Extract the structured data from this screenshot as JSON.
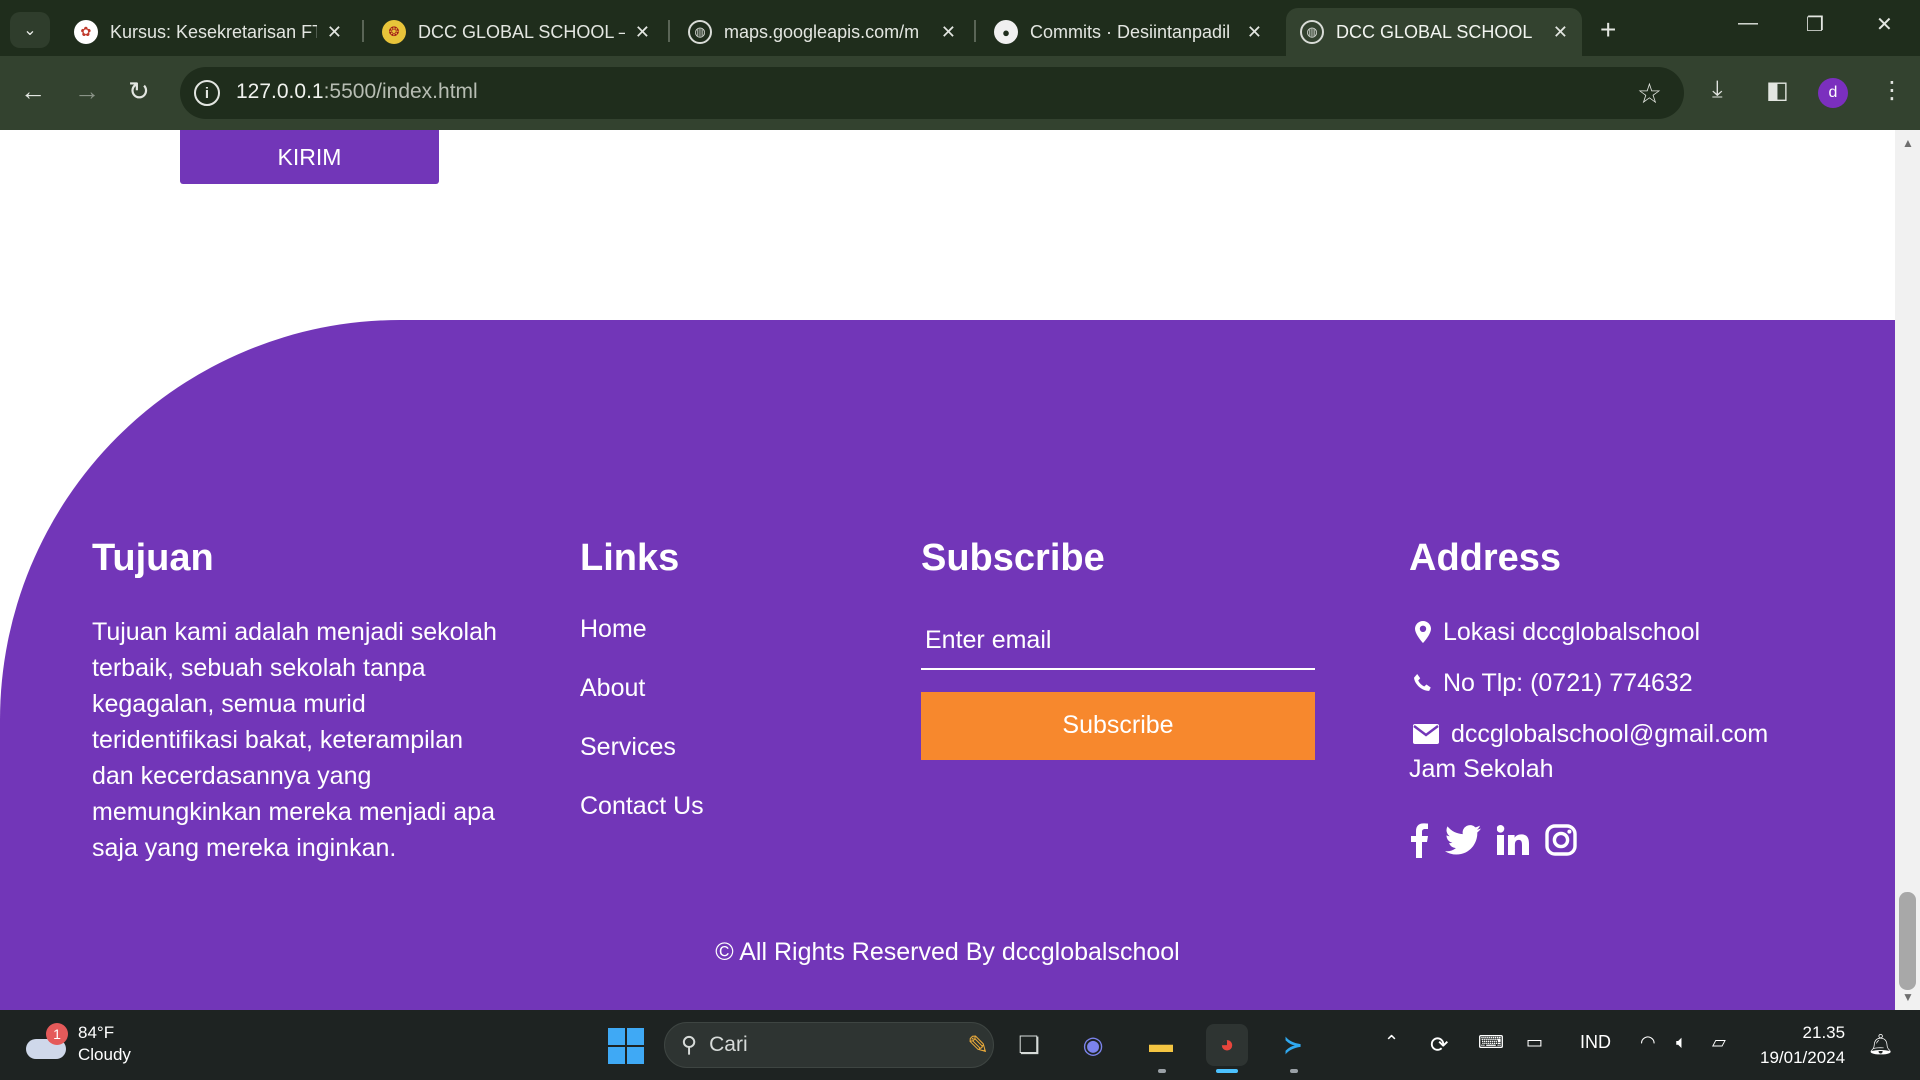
{
  "browser": {
    "tabs": [
      {
        "title": "Kursus: Kesekretarisan FT",
        "favicon": "university-favicon",
        "active": false
      },
      {
        "title": "DCC GLOBAL SCHOOL – |",
        "favicon": "school-logo-favicon",
        "active": false
      },
      {
        "title": "maps.googleapis.com/m",
        "favicon": "globe-favicon",
        "active": false
      },
      {
        "title": "Commits · Desiintanpadil",
        "favicon": "github-favicon",
        "active": false
      },
      {
        "title": "DCC GLOBAL SCHOOL",
        "favicon": "globe-favicon",
        "active": true
      }
    ],
    "url_host": "127.0.0.1",
    "url_path": ":5500/index.html",
    "profile_initial": "d"
  },
  "page": {
    "kirim_label": "KIRIM",
    "footer": {
      "tujuan": {
        "heading": "Tujuan",
        "text": "Tujuan kami adalah menjadi sekolah terbaik, sebuah sekolah tanpa kegagalan, semua murid teridentifikasi bakat, keterampilan dan kecerdasannya yang memungkinkan mereka menjadi apa saja yang mereka inginkan."
      },
      "links": {
        "heading": "Links",
        "items": [
          "Home",
          "About",
          "Services",
          "Contact Us"
        ]
      },
      "subscribe": {
        "heading": "Subscribe",
        "email_placeholder": "Enter email",
        "button_label": "Subscribe"
      },
      "address": {
        "heading": "Address",
        "location": "Lokasi dccglobalschool",
        "phone": "No Tlp: (0721) 774632",
        "email": "dccglobalschool@gmail.com",
        "hours": "Jam Sekolah",
        "social": [
          "facebook-icon",
          "twitter-icon",
          "linkedin-icon",
          "instagram-icon"
        ]
      },
      "copyright": "© All Rights Reserved By dccglobalschool"
    },
    "colors": {
      "primary": "#7236b8",
      "accent": "#f7882d"
    }
  },
  "taskbar": {
    "weather_temp": "84°F",
    "weather_desc": "Cloudy",
    "weather_badge": "1",
    "search_placeholder": "Cari",
    "language": "IND",
    "time": "21.35",
    "date": "19/01/2024"
  }
}
